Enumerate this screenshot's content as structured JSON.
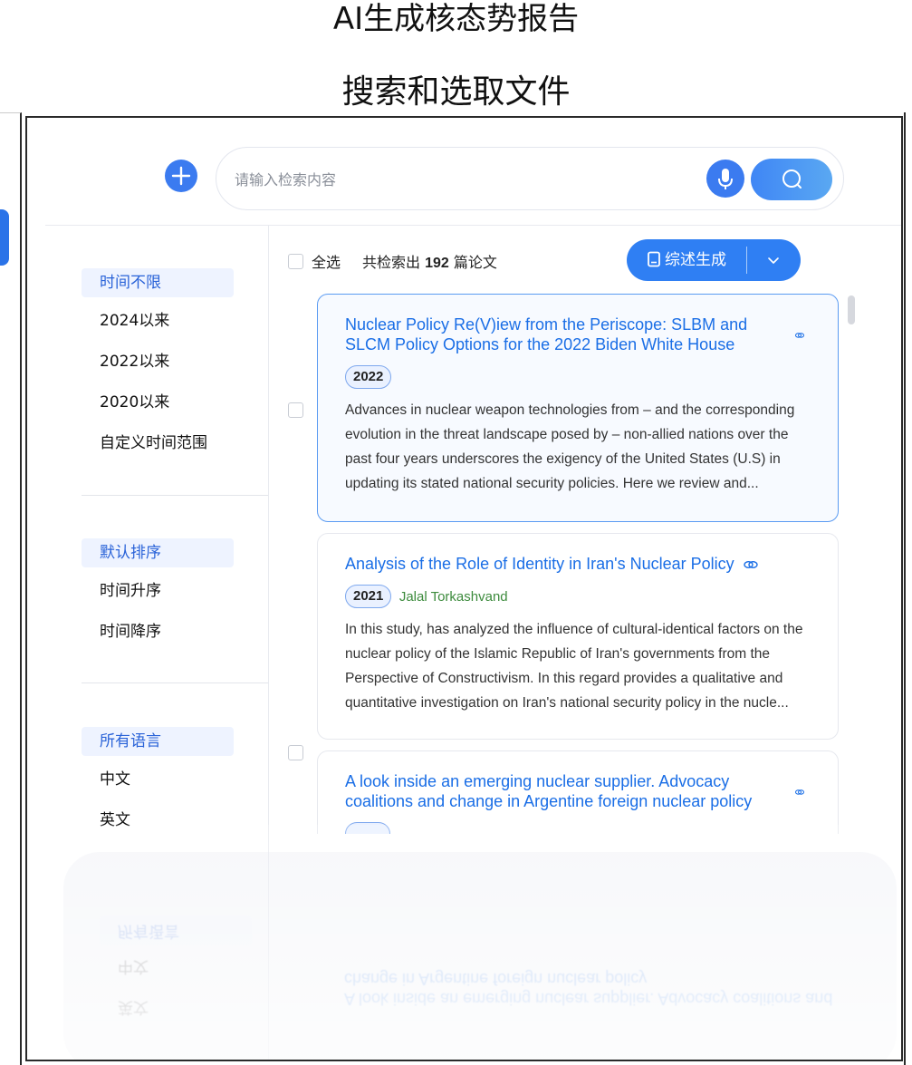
{
  "page": {
    "title": "AI生成核态势报告",
    "subtitle": "搜索和选取文件"
  },
  "search": {
    "placeholder": "请输入检索内容",
    "add_icon": "plus-icon",
    "mic_icon": "microphone-icon",
    "search_icon": "search-icon"
  },
  "filters": {
    "time": {
      "active": "时间不限",
      "options": [
        "2024以来",
        "2022以来",
        "2020以来",
        "自定义时间范围"
      ]
    },
    "sort": {
      "active": "默认排序",
      "options": [
        "时间升序",
        "时间降序"
      ]
    },
    "language": {
      "active": "所有语言",
      "options": [
        "中文",
        "英文"
      ]
    }
  },
  "results_header": {
    "select_all": "全选",
    "count_prefix": "共检索出",
    "count": "192",
    "count_suffix": "篇论文",
    "generate_label": "综述生成",
    "generate_icon": "document-icon",
    "dropdown_icon": "chevron-down-icon"
  },
  "results": [
    {
      "title": "Nuclear Policy Re(V)iew from the Periscope: SLBM and SLCM Policy Options for the 2022 Biden White House",
      "year": "2022",
      "author": "",
      "abstract": "Advances in nuclear weapon technologies from – and the corresponding evolution in the threat landscape posed by – non-allied nations over the past four years underscores the exigency of the United States (U.S) in updating its stated national security policies. Here we review and..."
    },
    {
      "title": "Analysis of the Role of Identity in Iran's Nuclear Policy",
      "year": "2021",
      "author": "Jalal Torkashvand",
      "abstract": "In this study, has analyzed the influence of cultural-identical factors on the nuclear policy of the Islamic Republic of Iran's governments from the Perspective of Constructivism. In this regard provides a qualitative and quantitative investigation on Iran's national security policy in the nucle..."
    },
    {
      "title": "A look inside an emerging nuclear supplier. Advocacy coalitions and change in Argentine foreign nuclear policy",
      "year": "",
      "author": "",
      "abstract": ""
    }
  ],
  "colors": {
    "accent": "#2f7ff3",
    "link": "#1a6ee6",
    "author": "#3d8b3d",
    "filter_active_bg": "#eef3ff"
  }
}
